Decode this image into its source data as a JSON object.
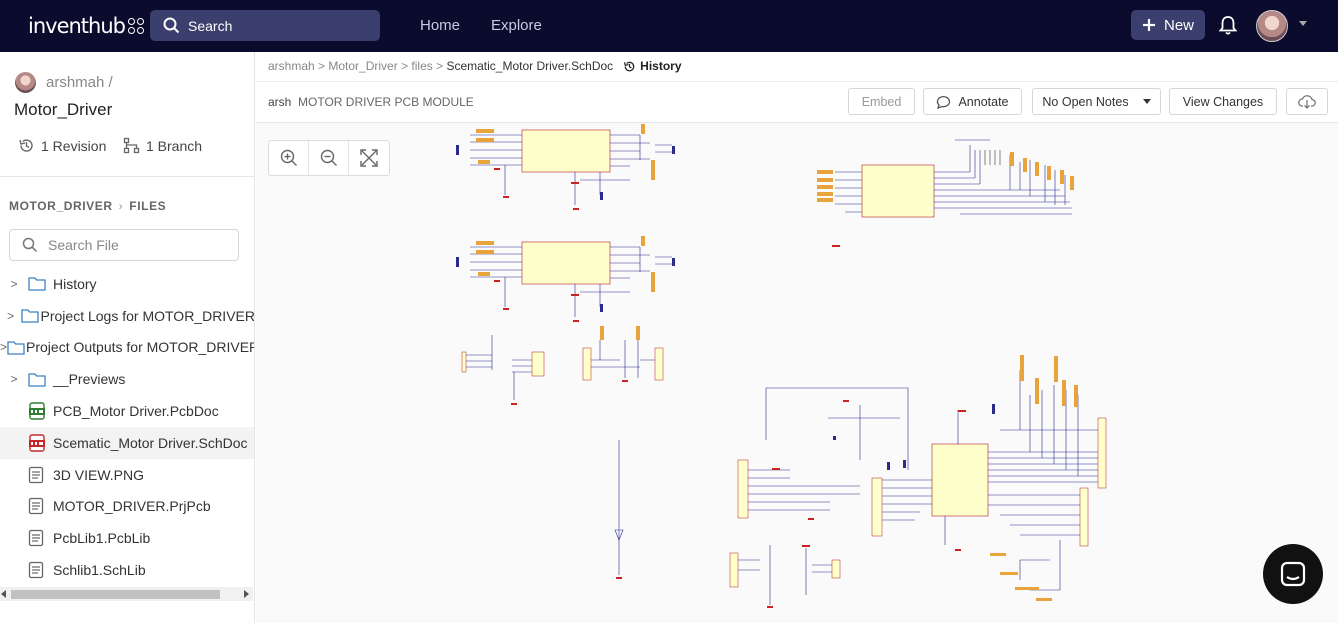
{
  "topbar": {
    "logo": "inventhub",
    "search_label": "Search",
    "nav": [
      "Home",
      "Explore"
    ],
    "new_label": "New"
  },
  "sidebar": {
    "owner": "arshmah /",
    "repo": "Motor_Driver",
    "revisions": "1 Revision",
    "branches": "1 Branch",
    "crumb_root": "MOTOR_DRIVER",
    "crumb_leaf": "FILES",
    "file_search_placeholder": "Search File",
    "items": [
      {
        "label": "History",
        "type": "folder"
      },
      {
        "label": "Project Logs for MOTOR_DRIVER",
        "type": "folder"
      },
      {
        "label": "Project Outputs for MOTOR_DRIVER",
        "type": "folder"
      },
      {
        "label": "__Previews",
        "type": "folder"
      },
      {
        "label": "PCB_Motor Driver.PcbDoc",
        "type": "pcb"
      },
      {
        "label": "Scematic_Motor Driver.SchDoc",
        "type": "sch",
        "selected": true
      },
      {
        "label": "3D VIEW.PNG",
        "type": "file"
      },
      {
        "label": "MOTOR_DRIVER.PrjPcb",
        "type": "file"
      },
      {
        "label": "PcbLib1.PcbLib",
        "type": "file"
      },
      {
        "label": "Schlib1.SchLib",
        "type": "file"
      }
    ]
  },
  "main": {
    "breadcrumb": [
      "arshmah",
      "Motor_Driver",
      "files",
      "Scematic_Motor Driver.SchDoc"
    ],
    "history_label": "History",
    "author": "arsh",
    "commit_title": "MOTOR DRIVER PCB MODULE",
    "buttons": {
      "embed": "Embed",
      "annotate": "Annotate",
      "notes": "No Open Notes",
      "view_changes": "View Changes"
    }
  },
  "colors": {
    "topbar_bg": "#0b0b2e",
    "component_fill": "#ffffcc",
    "wire": "#2b2b8f",
    "net_red": "#cc2222",
    "port_orange": "#e8a33a"
  }
}
